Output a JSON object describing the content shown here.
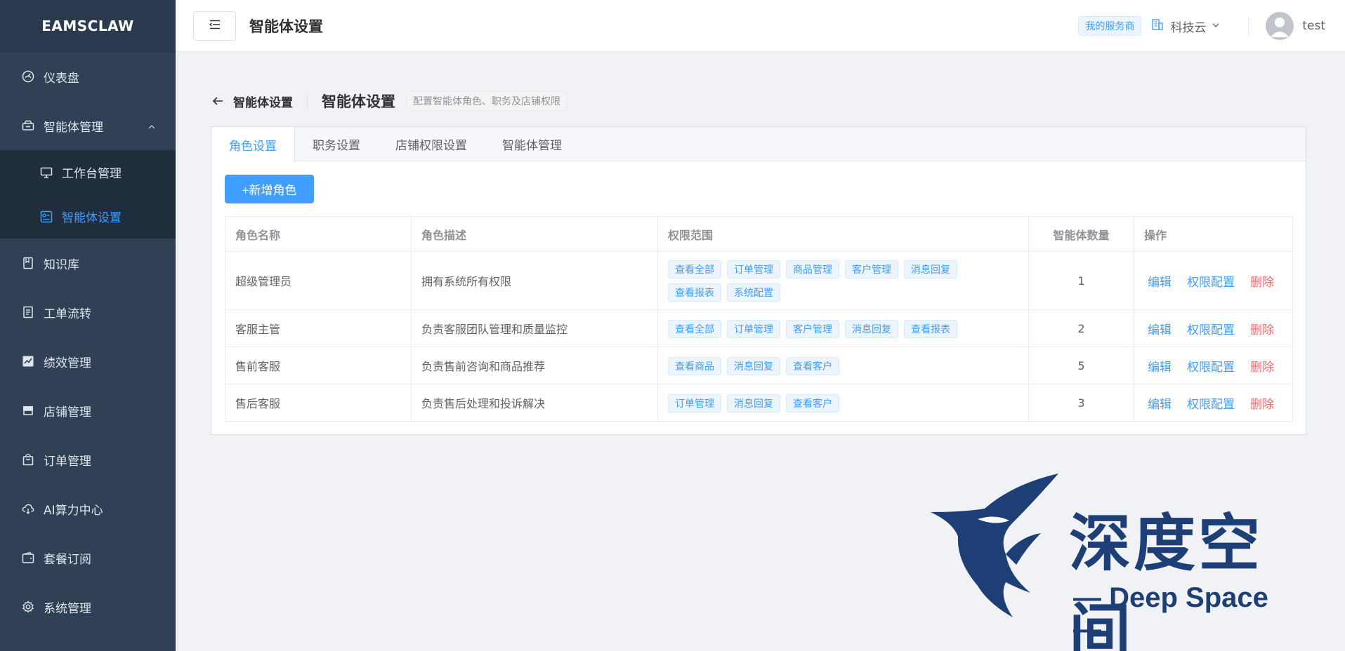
{
  "app": {
    "logo": "EAMSCLAW"
  },
  "sidebar": {
    "items": [
      {
        "label": "仪表盘",
        "icon": "dashboard-icon"
      },
      {
        "label": "智能体管理",
        "icon": "agent-icon",
        "expanded": true,
        "children": [
          {
            "label": "工作台管理",
            "icon": "monitor-icon"
          },
          {
            "label": "智能体设置",
            "icon": "settings-panel-icon",
            "active": true
          }
        ]
      },
      {
        "label": "知识库",
        "icon": "book-icon"
      },
      {
        "label": "工单流转",
        "icon": "document-icon"
      },
      {
        "label": "绩效管理",
        "icon": "chart-icon"
      },
      {
        "label": "店铺管理",
        "icon": "store-icon"
      },
      {
        "label": "订单管理",
        "icon": "bag-icon"
      },
      {
        "label": "AI算力中心",
        "icon": "cloud-icon"
      },
      {
        "label": "套餐订阅",
        "icon": "wallet-icon"
      },
      {
        "label": "系统管理",
        "icon": "gear-icon"
      }
    ]
  },
  "header": {
    "title": "智能体设置",
    "provider_badge": "我的服务商",
    "company": "科技云",
    "username": "test"
  },
  "page": {
    "back_label": "智能体设置",
    "title": "智能体设置",
    "description": "配置智能体角色、职务及店铺权限"
  },
  "tabs": [
    {
      "label": "角色设置",
      "active": true
    },
    {
      "label": "职务设置"
    },
    {
      "label": "店铺权限设置"
    },
    {
      "label": "智能体管理"
    }
  ],
  "add_button": "+新增角色",
  "table": {
    "columns": [
      "角色名称",
      "角色描述",
      "权限范围",
      "智能体数量",
      "操作"
    ],
    "rows": [
      {
        "name": "超级管理员",
        "desc": "拥有系统所有权限",
        "perms": [
          "查看全部",
          "订单管理",
          "商品管理",
          "客户管理",
          "消息回复",
          "查看报表",
          "系统配置"
        ],
        "count": "1"
      },
      {
        "name": "客服主管",
        "desc": "负责客服团队管理和质量监控",
        "perms": [
          "查看全部",
          "订单管理",
          "客户管理",
          "消息回复",
          "查看报表"
        ],
        "count": "2"
      },
      {
        "name": "售前客服",
        "desc": "负责售前咨询和商品推荐",
        "perms": [
          "查看商品",
          "消息回复",
          "查看客户"
        ],
        "count": "5"
      },
      {
        "name": "售后客服",
        "desc": "负责售后处理和投诉解决",
        "perms": [
          "订单管理",
          "消息回复",
          "查看客户"
        ],
        "count": "3"
      }
    ],
    "actions": {
      "edit": "编辑",
      "perm_config": "权限配置",
      "delete": "删除"
    }
  },
  "watermark": {
    "cn": "深度空间",
    "en": "— Deep Space —"
  },
  "colors": {
    "sidebar_bg": "#304156",
    "accent": "#409eff",
    "danger": "#f56c6c"
  }
}
